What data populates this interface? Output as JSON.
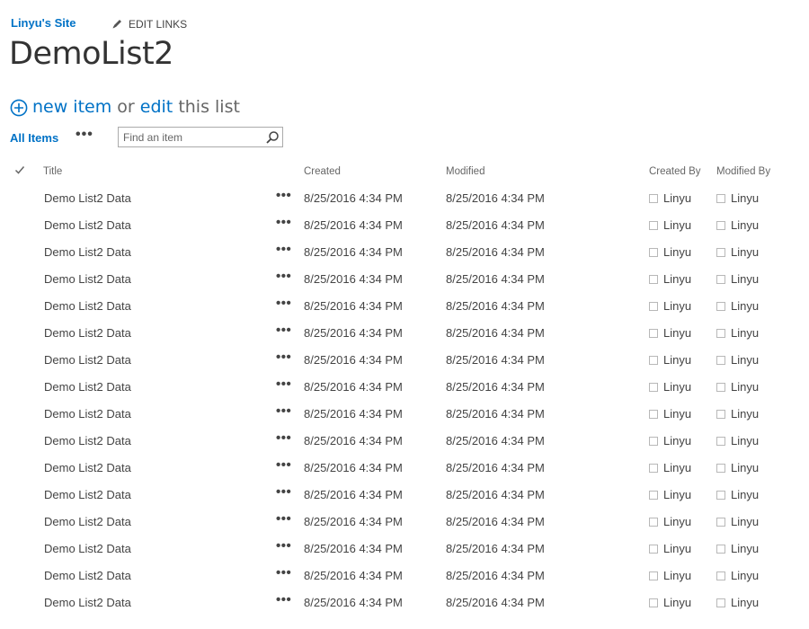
{
  "header": {
    "site_name": "Linyu's Site",
    "edit_links": "EDIT LINKS",
    "page_title": "DemoList2"
  },
  "toolbar": {
    "new_item": "new item",
    "or": "or",
    "edit": "edit",
    "this_list": "this list",
    "view_name": "All Items",
    "view_menu": "•••",
    "search_placeholder": "Find an item"
  },
  "columns": {
    "title": "Title",
    "created": "Created",
    "modified": "Modified",
    "created_by": "Created By",
    "modified_by": "Modified By"
  },
  "item_menu_label": "•••",
  "rows": [
    {
      "title": "Demo List2 Data",
      "created": "8/25/2016 4:34 PM",
      "modified": "8/25/2016 4:34 PM",
      "created_by": "Linyu",
      "modified_by": "Linyu"
    },
    {
      "title": "Demo List2 Data",
      "created": "8/25/2016 4:34 PM",
      "modified": "8/25/2016 4:34 PM",
      "created_by": "Linyu",
      "modified_by": "Linyu"
    },
    {
      "title": "Demo List2 Data",
      "created": "8/25/2016 4:34 PM",
      "modified": "8/25/2016 4:34 PM",
      "created_by": "Linyu",
      "modified_by": "Linyu"
    },
    {
      "title": "Demo List2 Data",
      "created": "8/25/2016 4:34 PM",
      "modified": "8/25/2016 4:34 PM",
      "created_by": "Linyu",
      "modified_by": "Linyu"
    },
    {
      "title": "Demo List2 Data",
      "created": "8/25/2016 4:34 PM",
      "modified": "8/25/2016 4:34 PM",
      "created_by": "Linyu",
      "modified_by": "Linyu"
    },
    {
      "title": "Demo List2 Data",
      "created": "8/25/2016 4:34 PM",
      "modified": "8/25/2016 4:34 PM",
      "created_by": "Linyu",
      "modified_by": "Linyu"
    },
    {
      "title": "Demo List2 Data",
      "created": "8/25/2016 4:34 PM",
      "modified": "8/25/2016 4:34 PM",
      "created_by": "Linyu",
      "modified_by": "Linyu"
    },
    {
      "title": "Demo List2 Data",
      "created": "8/25/2016 4:34 PM",
      "modified": "8/25/2016 4:34 PM",
      "created_by": "Linyu",
      "modified_by": "Linyu"
    },
    {
      "title": "Demo List2 Data",
      "created": "8/25/2016 4:34 PM",
      "modified": "8/25/2016 4:34 PM",
      "created_by": "Linyu",
      "modified_by": "Linyu"
    },
    {
      "title": "Demo List2 Data",
      "created": "8/25/2016 4:34 PM",
      "modified": "8/25/2016 4:34 PM",
      "created_by": "Linyu",
      "modified_by": "Linyu"
    },
    {
      "title": "Demo List2 Data",
      "created": "8/25/2016 4:34 PM",
      "modified": "8/25/2016 4:34 PM",
      "created_by": "Linyu",
      "modified_by": "Linyu"
    },
    {
      "title": "Demo List2 Data",
      "created": "8/25/2016 4:34 PM",
      "modified": "8/25/2016 4:34 PM",
      "created_by": "Linyu",
      "modified_by": "Linyu"
    },
    {
      "title": "Demo List2 Data",
      "created": "8/25/2016 4:34 PM",
      "modified": "8/25/2016 4:34 PM",
      "created_by": "Linyu",
      "modified_by": "Linyu"
    },
    {
      "title": "Demo List2 Data",
      "created": "8/25/2016 4:34 PM",
      "modified": "8/25/2016 4:34 PM",
      "created_by": "Linyu",
      "modified_by": "Linyu"
    },
    {
      "title": "Demo List2 Data",
      "created": "8/25/2016 4:34 PM",
      "modified": "8/25/2016 4:34 PM",
      "created_by": "Linyu",
      "modified_by": "Linyu"
    },
    {
      "title": "Demo List2 Data",
      "created": "8/25/2016 4:34 PM",
      "modified": "8/25/2016 4:34 PM",
      "created_by": "Linyu",
      "modified_by": "Linyu"
    }
  ],
  "icons": {
    "pencil": "pencil-icon",
    "add": "plus-circle-icon",
    "search": "search-icon",
    "select_all": "checkmark-icon",
    "user_presence": "presence-square-icon"
  },
  "colors": {
    "link_blue": "#0072c6",
    "text": "#444444",
    "muted": "#666666"
  }
}
